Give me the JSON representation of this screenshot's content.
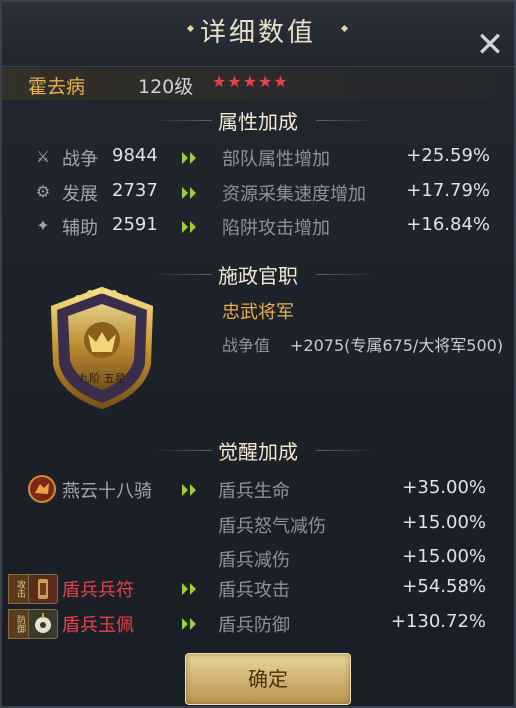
{
  "window": {
    "title": "详细数值"
  },
  "hero": {
    "name": "霍去病",
    "level": "120级",
    "stars": "★★★★★"
  },
  "sections": {
    "attr": "属性加成",
    "office": "施政官职",
    "awaken": "觉醒加成"
  },
  "stats": [
    {
      "icon": "sword-icon",
      "name": "战争",
      "value": "9844",
      "bonus": "部队属性增加",
      "pct": "+25.59%"
    },
    {
      "icon": "develop-icon",
      "name": "发展",
      "value": "2737",
      "bonus": "资源采集速度增加",
      "pct": "+17.79%"
    },
    {
      "icon": "assist-icon",
      "name": "辅助",
      "value": "2591",
      "bonus": "陷阱攻击增加",
      "pct": "+16.84%"
    }
  ],
  "office": {
    "emblem_text": "九阶 五星",
    "title": "忠武将军",
    "label": "战争值",
    "value": "+2075(专属675/大将军500)"
  },
  "awaken": {
    "skill_name": "燕云十八骑",
    "rows": [
      {
        "name": "盾兵生命",
        "pct": "+35.00%"
      },
      {
        "name": "盾兵怒气减伤",
        "pct": "+15.00%"
      },
      {
        "name": "盾兵减伤",
        "pct": "+15.00%"
      }
    ]
  },
  "items": [
    {
      "badge": "攻击",
      "name": "盾兵兵符",
      "bonus": "盾兵攻击",
      "pct": "+54.58%"
    },
    {
      "badge": "防御",
      "name": "盾兵玉佩",
      "bonus": "盾兵防御",
      "pct": "+130.72%"
    }
  ],
  "buttons": {
    "confirm": "确定"
  },
  "colors": {
    "gold": "#e6b14e",
    "red": "#e5434a",
    "arrow": "#9ccf3a"
  }
}
